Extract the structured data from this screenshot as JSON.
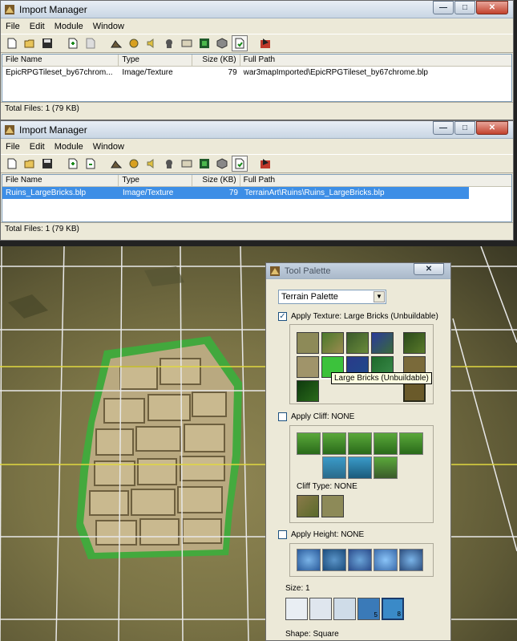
{
  "import_manager_1": {
    "title": "Import Manager",
    "menu": [
      "File",
      "Edit",
      "Module",
      "Window"
    ],
    "columns": [
      "File Name",
      "Type",
      "Size (KB)",
      "Full Path"
    ],
    "rows": [
      {
        "name": "EpicRPGTileset_by67chrom...",
        "type": "Image/Texture",
        "size": "79",
        "path": "war3mapImported\\EpicRPGTileset_by67chrome.blp"
      }
    ],
    "status": "Total Files: 1 (79 KB)"
  },
  "import_manager_2": {
    "title": "Import Manager",
    "menu": [
      "File",
      "Edit",
      "Module",
      "Window"
    ],
    "columns": [
      "File Name",
      "Type",
      "Size (KB)",
      "Full Path"
    ],
    "rows": [
      {
        "name": "Ruins_LargeBricks.blp",
        "type": "Image/Texture",
        "size": "79",
        "path": "TerrainArt\\Ruins\\Ruins_LargeBricks.blp"
      }
    ],
    "status": "Total Files: 1 (79 KB)"
  },
  "tool_palette": {
    "title": "Tool Palette",
    "close_label": "✕",
    "palette_select": "Terrain Palette",
    "apply_texture": "Apply Texture: Large Bricks (Unbuildable)",
    "tooltip": "Large Bricks (Unbuildable)",
    "apply_cliff": "Apply Cliff: NONE",
    "cliff_type": "Cliff Type: NONE",
    "apply_height": "Apply Height: NONE",
    "size_label": "Size: 1",
    "size_badges": [
      "5",
      "8"
    ],
    "shape_label": "Shape: Square"
  },
  "window_buttons": {
    "minimize": "—",
    "maximize": "□",
    "close": "✕"
  },
  "colors": {
    "selection": "#3d8ee6",
    "grid_white": "#e8e8e8",
    "grid_yellow": "#e0d840",
    "tile_green": "#3cae3c"
  }
}
